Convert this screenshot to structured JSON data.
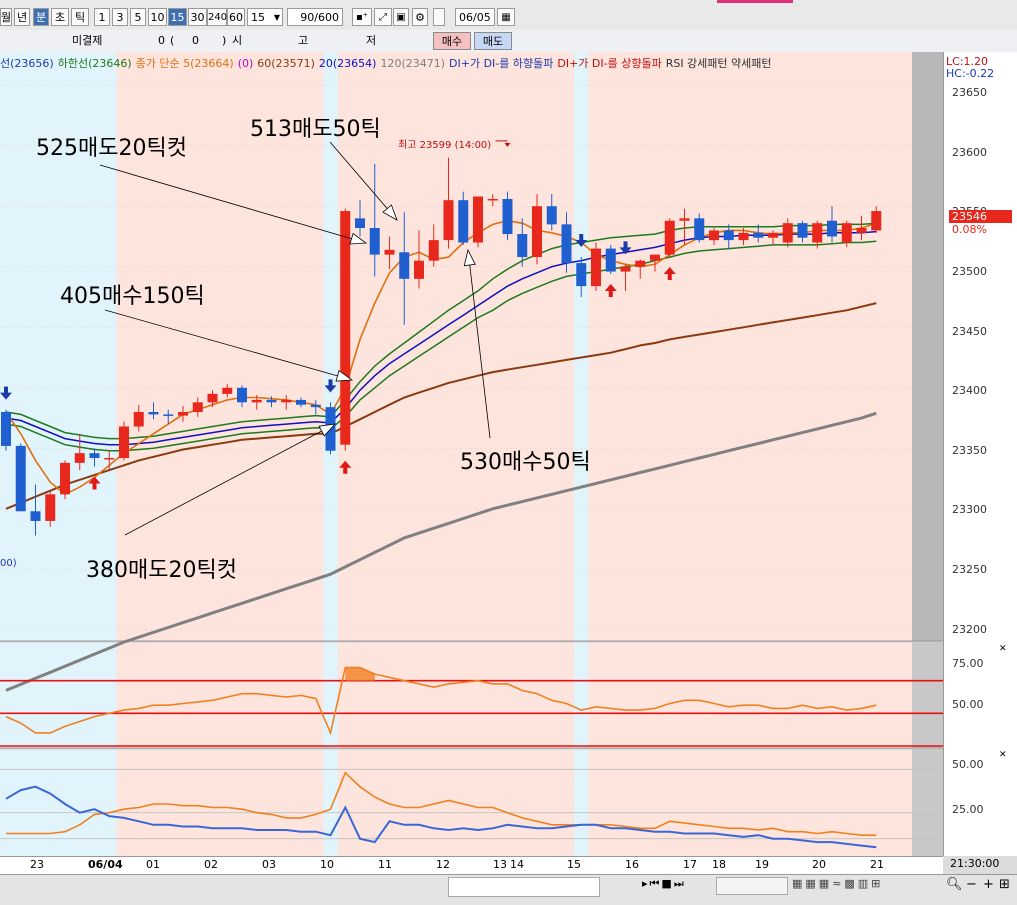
{
  "toolbar": {
    "items": [
      "월",
      "년",
      "분",
      "초",
      "틱",
      "1",
      "3",
      "5",
      "10",
      "15",
      "30",
      "240",
      "60"
    ],
    "selected_unit": "분",
    "selected_interval": "15",
    "interval_value": "15",
    "count_value": "90",
    "count_total": "/600",
    "date_value": "06/05"
  },
  "orderbar": {
    "unfilled_label": "미결제",
    "unfilled_value": "0",
    "unfilled_paren_open": "(",
    "unfilled_paren_value": "0",
    "unfilled_paren_close": ")",
    "open_label": "시",
    "high_label": "고",
    "low_label": "저",
    "buy_button": "매수",
    "sell_button": "매도"
  },
  "legend": {
    "items": [
      {
        "text": "선(23656)",
        "color": "#1c3ab0"
      },
      {
        "text": "하한선(23646)",
        "color": "#1d7a1d"
      },
      {
        "text": "종가 단순 5(23664)",
        "color": "#e07010"
      },
      {
        "text": "(0)",
        "color": "#c000c0"
      },
      {
        "text": "60(23571)",
        "color": "#8a3a10"
      },
      {
        "text": "20(23654)",
        "color": "#1010c0"
      },
      {
        "text": "120(23471)",
        "color": "#808080"
      },
      {
        "text": "DI+가 DI-를 하향돌파",
        "color": "#1c3ab0"
      },
      {
        "text": "DI+가 DI-를 상향돌파",
        "color": "#c01010"
      },
      {
        "text": "RSI 강세패턴  약세패턴",
        "color": "#303030"
      }
    ],
    "lc": "LC:1.20",
    "hc": "HC:-0.22"
  },
  "price_axis": {
    "ticks": [
      "23650",
      "23600",
      "23550",
      "23500",
      "23450",
      "23400",
      "23350",
      "23300",
      "23250",
      "23200"
    ],
    "current_price": "23546",
    "current_change": "0.08%"
  },
  "rsi_axis": {
    "ticks": [
      "75.00",
      "50.00"
    ]
  },
  "di_axis": {
    "ticks": [
      "50.00",
      "25.00"
    ]
  },
  "x_axis": {
    "labels": [
      "23",
      "06/04",
      "01",
      "02",
      "03",
      "10",
      "11",
      "12",
      "13",
      "14",
      "15",
      "16",
      "17",
      "18",
      "19",
      "20",
      "21"
    ],
    "time": "21:30:00"
  },
  "annotations": {
    "a525": "525매도20틱컷",
    "a513": "513매도50틱",
    "a405": "405매수150틱",
    "a530": "530매수50틱",
    "a380": "380매도20틱컷",
    "high_label": "최고 23599 (14:00)",
    "low_label": "00)"
  },
  "colors": {
    "up": "#e8281c",
    "down": "#1f5fd0",
    "ma5": "#e07010",
    "ma20": "#1010c0",
    "envelope": "#1d7a1d",
    "ma60": "#8a3a10",
    "ma120": "#808080",
    "rsi": "#f08020",
    "di_plus": "#f08020",
    "di_minus": "#3a66d8",
    "annotation_blue": "#2838c8",
    "annotation_red": "#d82828"
  },
  "chart_data": {
    "type": "candlestick",
    "ylim": [
      23190,
      23665
    ],
    "candles": [
      {
        "o": 23380,
        "h": 23382,
        "l": 23348,
        "c": 23352
      },
      {
        "o": 23352,
        "h": 23354,
        "l": 23298,
        "c": 23298
      },
      {
        "o": 23298,
        "h": 23320,
        "l": 23278,
        "c": 23290
      },
      {
        "o": 23290,
        "h": 23315,
        "l": 23285,
        "c": 23312
      },
      {
        "o": 23312,
        "h": 23340,
        "l": 23308,
        "c": 23338
      },
      {
        "o": 23338,
        "h": 23362,
        "l": 23332,
        "c": 23346
      },
      {
        "o": 23346,
        "h": 23350,
        "l": 23335,
        "c": 23342
      },
      {
        "o": 23342,
        "h": 23348,
        "l": 23333,
        "c": 23342
      },
      {
        "o": 23342,
        "h": 23372,
        "l": 23340,
        "c": 23368
      },
      {
        "o": 23368,
        "h": 23386,
        "l": 23364,
        "c": 23380
      },
      {
        "o": 23380,
        "h": 23388,
        "l": 23374,
        "c": 23378
      },
      {
        "o": 23378,
        "h": 23382,
        "l": 23370,
        "c": 23377
      },
      {
        "o": 23377,
        "h": 23385,
        "l": 23372,
        "c": 23380
      },
      {
        "o": 23380,
        "h": 23392,
        "l": 23376,
        "c": 23388
      },
      {
        "o": 23388,
        "h": 23398,
        "l": 23384,
        "c": 23395
      },
      {
        "o": 23395,
        "h": 23403,
        "l": 23392,
        "c": 23400
      },
      {
        "o": 23400,
        "h": 23402,
        "l": 23384,
        "c": 23388
      },
      {
        "o": 23388,
        "h": 23394,
        "l": 23382,
        "c": 23390
      },
      {
        "o": 23390,
        "h": 23393,
        "l": 23384,
        "c": 23388
      },
      {
        "o": 23388,
        "h": 23394,
        "l": 23382,
        "c": 23390
      },
      {
        "o": 23390,
        "h": 23392,
        "l": 23384,
        "c": 23386
      },
      {
        "o": 23386,
        "h": 23390,
        "l": 23378,
        "c": 23384
      },
      {
        "o": 23384,
        "h": 23388,
        "l": 23345,
        "c": 23348
      },
      {
        "o": 23353,
        "h": 23548,
        "l": 23348,
        "c": 23546
      },
      {
        "o": 23540,
        "h": 23555,
        "l": 23525,
        "c": 23532
      },
      {
        "o": 23532,
        "h": 23585,
        "l": 23492,
        "c": 23510
      },
      {
        "o": 23510,
        "h": 23525,
        "l": 23498,
        "c": 23514
      },
      {
        "o": 23512,
        "h": 23545,
        "l": 23452,
        "c": 23490
      },
      {
        "o": 23490,
        "h": 23530,
        "l": 23482,
        "c": 23505
      },
      {
        "o": 23505,
        "h": 23535,
        "l": 23500,
        "c": 23522
      },
      {
        "o": 23522,
        "h": 23590,
        "l": 23515,
        "c": 23555
      },
      {
        "o": 23555,
        "h": 23562,
        "l": 23518,
        "c": 23520
      },
      {
        "o": 23520,
        "h": 23558,
        "l": 23516,
        "c": 23558
      },
      {
        "o": 23556,
        "h": 23560,
        "l": 23550,
        "c": 23556
      },
      {
        "o": 23556,
        "h": 23562,
        "l": 23522,
        "c": 23527
      },
      {
        "o": 23527,
        "h": 23540,
        "l": 23500,
        "c": 23508
      },
      {
        "o": 23508,
        "h": 23560,
        "l": 23502,
        "c": 23550
      },
      {
        "o": 23550,
        "h": 23560,
        "l": 23530,
        "c": 23535
      },
      {
        "o": 23535,
        "h": 23545,
        "l": 23495,
        "c": 23503
      },
      {
        "o": 23503,
        "h": 23508,
        "l": 23475,
        "c": 23484
      },
      {
        "o": 23484,
        "h": 23520,
        "l": 23480,
        "c": 23515
      },
      {
        "o": 23515,
        "h": 23518,
        "l": 23494,
        "c": 23496
      },
      {
        "o": 23496,
        "h": 23502,
        "l": 23480,
        "c": 23500
      },
      {
        "o": 23500,
        "h": 23506,
        "l": 23490,
        "c": 23505
      },
      {
        "o": 23505,
        "h": 23510,
        "l": 23496,
        "c": 23510
      },
      {
        "o": 23510,
        "h": 23540,
        "l": 23508,
        "c": 23538
      },
      {
        "o": 23538,
        "h": 23548,
        "l": 23518,
        "c": 23540
      },
      {
        "o": 23540,
        "h": 23544,
        "l": 23520,
        "c": 23522
      },
      {
        "o": 23522,
        "h": 23532,
        "l": 23518,
        "c": 23530
      },
      {
        "o": 23530,
        "h": 23535,
        "l": 23515,
        "c": 23522
      },
      {
        "o": 23522,
        "h": 23532,
        "l": 23518,
        "c": 23528
      },
      {
        "o": 23528,
        "h": 23535,
        "l": 23520,
        "c": 23524
      },
      {
        "o": 23524,
        "h": 23530,
        "l": 23518,
        "c": 23528
      },
      {
        "o": 23520,
        "h": 23540,
        "l": 23516,
        "c": 23536
      },
      {
        "o": 23536,
        "h": 23538,
        "l": 23520,
        "c": 23524
      },
      {
        "o": 23520,
        "h": 23538,
        "l": 23515,
        "c": 23536
      },
      {
        "o": 23538,
        "h": 23550,
        "l": 23520,
        "c": 23525
      },
      {
        "o": 23520,
        "h": 23538,
        "l": 23516,
        "c": 23536
      },
      {
        "o": 23528,
        "h": 23542,
        "l": 23522,
        "c": 23532
      },
      {
        "o": 23530,
        "h": 23550,
        "l": 23528,
        "c": 23546
      }
    ],
    "ma5": [
      23380,
      23362,
      23340,
      23322,
      23312,
      23318,
      23326,
      23336,
      23346,
      23354,
      23362,
      23370,
      23378,
      23382,
      23386,
      23390,
      23392,
      23392,
      23391,
      23390,
      23388,
      23386,
      23378,
      23400,
      23440,
      23470,
      23495,
      23508,
      23512,
      23506,
      23508,
      23520,
      23528,
      23535,
      23538,
      23536,
      23530,
      23528,
      23525,
      23520,
      23510,
      23505,
      23502,
      23500,
      23502,
      23510,
      23518,
      23524,
      23528,
      23530,
      23530,
      23528,
      23527,
      23528,
      23528,
      23530,
      23530,
      23530,
      23532,
      23536
    ],
    "ma20": [
      23375,
      23373,
      23368,
      23363,
      23358,
      23356,
      23354,
      23353,
      23353,
      23354,
      23355,
      23357,
      23359,
      23361,
      23363,
      23365,
      23367,
      23368,
      23369,
      23370,
      23371,
      23372,
      23371,
      23383,
      23398,
      23410,
      23420,
      23428,
      23436,
      23444,
      23452,
      23460,
      23468,
      23476,
      23484,
      23490,
      23495,
      23500,
      23503,
      23505,
      23508,
      23510,
      23512,
      23514,
      23516,
      23519,
      23522,
      23524,
      23525,
      23525,
      23526,
      23526,
      23526,
      23527,
      23527,
      23527,
      23528,
      23528,
      23528,
      23529
    ],
    "env_upper": [
      23380,
      23378,
      23373,
      23368,
      23363,
      23361,
      23359,
      23358,
      23358,
      23359,
      23360,
      23362,
      23364,
      23366,
      23368,
      23370,
      23372,
      23373,
      23374,
      23375,
      23376,
      23377,
      23376,
      23390,
      23405,
      23418,
      23428,
      23437,
      23446,
      23455,
      23464,
      23472,
      23480,
      23490,
      23498,
      23505,
      23510,
      23515,
      23518,
      23520,
      23522,
      23524,
      23525,
      23526,
      23527,
      23530,
      23532,
      23533,
      23533,
      23533,
      23533,
      23533,
      23533,
      23534,
      23534,
      23534,
      23535,
      23535,
      23535,
      23536
    ],
    "env_lower": [
      23370,
      23368,
      23363,
      23358,
      23353,
      23351,
      23349,
      23348,
      23348,
      23349,
      23350,
      23352,
      23354,
      23356,
      23358,
      23360,
      23362,
      23363,
      23364,
      23365,
      23366,
      23367,
      23366,
      23376,
      23390,
      23400,
      23410,
      23418,
      23426,
      23434,
      23442,
      23450,
      23458,
      23464,
      23472,
      23478,
      23483,
      23488,
      23492,
      23494,
      23496,
      23498,
      23500,
      23502,
      23505,
      23508,
      23511,
      23513,
      23514,
      23515,
      23516,
      23517,
      23518,
      23518,
      23518,
      23518,
      23519,
      23520,
      23520,
      23521
    ],
    "ma60": [
      23300,
      23305,
      23310,
      23315,
      23320,
      23324,
      23328,
      23332,
      23336,
      23340,
      23343,
      23346,
      23349,
      23351,
      23353,
      23355,
      23357,
      23358,
      23359,
      23360,
      23361,
      23362,
      23362,
      23368,
      23374,
      23380,
      23386,
      23392,
      23396,
      23400,
      23404,
      23407,
      23410,
      23413,
      23415,
      23417,
      23419,
      23421,
      23423,
      23425,
      23427,
      23429,
      23432,
      23435,
      23437,
      23440,
      23442,
      23444,
      23446,
      23448,
      23450,
      23452,
      23454,
      23456,
      23458,
      23460,
      23462,
      23464,
      23467,
      23470
    ],
    "ma120": [
      23150,
      23155,
      23160,
      23165,
      23170,
      23175,
      23180,
      23185,
      23190,
      23194,
      23198,
      23202,
      23206,
      23210,
      23214,
      23218,
      23222,
      23226,
      23230,
      23234,
      23238,
      23242,
      23246,
      23252,
      23258,
      23264,
      23270,
      23276,
      23280,
      23284,
      23288,
      23292,
      23296,
      23300,
      23303,
      23306,
      23309,
      23312,
      23315,
      23318,
      23321,
      23324,
      23327,
      23330,
      23333,
      23336,
      23339,
      23342,
      23345,
      23348,
      23351,
      23354,
      23357,
      23360,
      23363,
      23366,
      23369,
      23372,
      23375,
      23379
    ],
    "rsi": {
      "ylim": [
        30,
        90
      ],
      "values": [
        48,
        44,
        38,
        38,
        42,
        45,
        48,
        50,
        52,
        53,
        55,
        55,
        56,
        57,
        58,
        60,
        62,
        62,
        61,
        60,
        61,
        59,
        38,
        78,
        78,
        74,
        72,
        70,
        68,
        66,
        68,
        69,
        70,
        68,
        68,
        64,
        62,
        58,
        56,
        52,
        54,
        53,
        52,
        52,
        53,
        56,
        58,
        58,
        56,
        54,
        55,
        55,
        53,
        53,
        55,
        53,
        54,
        52,
        53,
        55
      ],
      "lines": [
        70,
        50,
        30
      ]
    },
    "di": {
      "ylim": [
        0,
        60
      ],
      "plus": [
        13,
        13,
        13,
        13,
        14,
        18,
        24,
        25,
        27,
        28,
        30,
        30,
        29,
        29,
        28,
        28,
        27,
        25,
        24,
        22,
        22,
        24,
        27,
        48,
        40,
        34,
        30,
        28,
        28,
        30,
        32,
        30,
        28,
        28,
        25,
        22,
        20,
        18,
        18,
        18,
        18,
        18,
        17,
        16,
        16,
        20,
        19,
        18,
        17,
        16,
        16,
        15,
        16,
        14,
        14,
        13,
        14,
        13,
        12,
        12
      ],
      "minus": [
        33,
        38,
        40,
        36,
        30,
        25,
        27,
        23,
        22,
        20,
        18,
        18,
        17,
        17,
        16,
        16,
        16,
        15,
        15,
        15,
        14,
        14,
        12,
        28,
        10,
        8,
        20,
        18,
        18,
        16,
        15,
        16,
        15,
        16,
        18,
        17,
        16,
        16,
        17,
        18,
        18,
        16,
        16,
        15,
        14,
        14,
        13,
        13,
        13,
        12,
        11,
        12,
        10,
        10,
        9,
        8,
        8,
        7,
        6,
        5
      ]
    },
    "highlight_bands": [
      {
        "from": 0,
        "to": 8,
        "color": "#e2f4fb"
      },
      {
        "from": 8,
        "to": 22,
        "color": "#fde4dc"
      },
      {
        "from": 22,
        "to": 23,
        "color": "#e2f4fb"
      },
      {
        "from": 23,
        "to": 39,
        "color": "#fde4dc"
      },
      {
        "from": 39,
        "to": 40,
        "color": "#e2f4fb"
      },
      {
        "from": 40,
        "to": 60,
        "color": "#fde4dc"
      }
    ],
    "signals_up": [
      6,
      23,
      41,
      45
    ],
    "signals_down": [
      0,
      22,
      39,
      42
    ]
  }
}
